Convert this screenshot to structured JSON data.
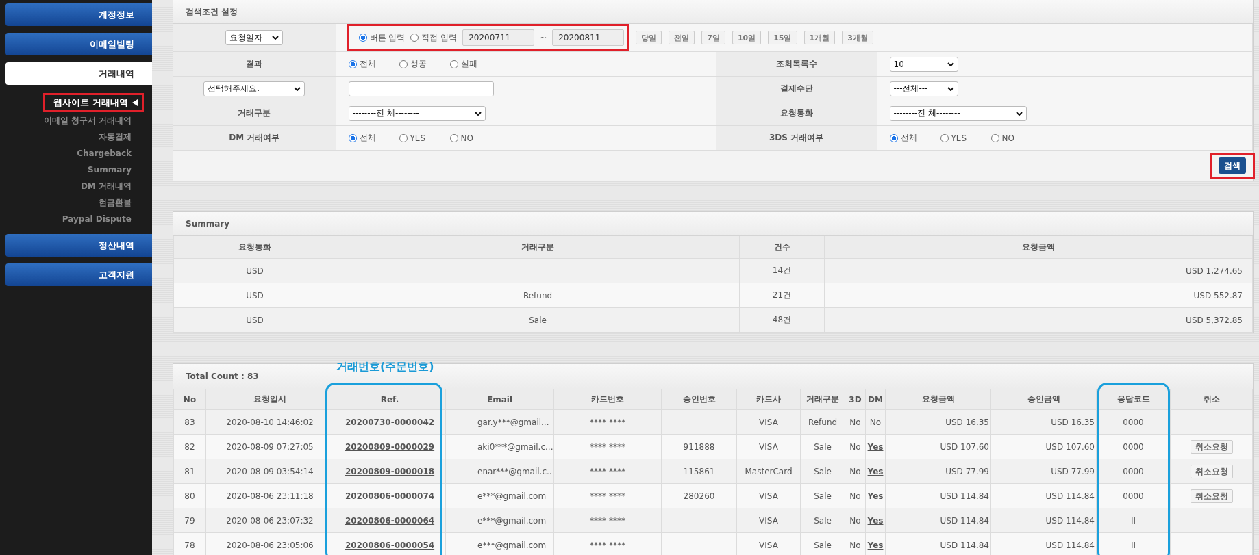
{
  "sidebar": {
    "menus": [
      {
        "label": "계정정보",
        "selected": false
      },
      {
        "label": "이메일빌링",
        "selected": false
      },
      {
        "label": "거래내역",
        "selected": true,
        "children": [
          {
            "label": "웹사이트 거래내역",
            "selected": true
          },
          {
            "label": "이메일 청구서 거래내역",
            "selected": false
          },
          {
            "label": "자동결제",
            "selected": false
          },
          {
            "label": "Chargeback",
            "selected": false
          },
          {
            "label": "Summary",
            "selected": false
          },
          {
            "label": "DM 거래내역",
            "selected": false
          },
          {
            "label": "현금환불",
            "selected": false
          },
          {
            "label": "Paypal Dispute",
            "selected": false
          }
        ]
      },
      {
        "label": "정산내역",
        "selected": false
      },
      {
        "label": "고객지원",
        "selected": false
      }
    ]
  },
  "search_panel": {
    "title": "검색조건 설정",
    "date_type": "요청일자",
    "date_modes": [
      {
        "label": "버튼 입력",
        "selected": true
      },
      {
        "label": "직접 입력",
        "selected": false
      }
    ],
    "date_from": "20200711",
    "date_separator": "~",
    "date_to": "20200811",
    "range_buttons": [
      "당일",
      "전일",
      "7일",
      "10일",
      "15일",
      "1개월",
      "3개월"
    ],
    "rows": [
      [
        {
          "label": "결과",
          "kind": "radio",
          "options": [
            {
              "label": "전체",
              "selected": true
            },
            {
              "label": "성공",
              "selected": false
            },
            {
              "label": "실패",
              "selected": false
            }
          ]
        },
        {
          "label": "조회목록수",
          "kind": "select",
          "value": "10"
        }
      ],
      [
        {
          "label_select": "선택해주세요.",
          "kind": "input"
        },
        {
          "label": "결제수단",
          "kind": "select",
          "value": "---전체---"
        }
      ],
      [
        {
          "label": "거래구분",
          "kind": "wide_select",
          "value": "--------전 체--------"
        },
        {
          "label": "요청통화",
          "kind": "wide_select",
          "value": "--------전 체--------"
        }
      ],
      [
        {
          "label": "DM 거래여부",
          "kind": "radio",
          "options": [
            {
              "label": "전체",
              "selected": true
            },
            {
              "label": "YES",
              "selected": false
            },
            {
              "label": "NO",
              "selected": false
            }
          ]
        },
        {
          "label": "3DS 거래여부",
          "kind": "radio",
          "options": [
            {
              "label": "전체",
              "selected": true
            },
            {
              "label": "YES",
              "selected": false
            },
            {
              "label": "NO",
              "selected": false
            }
          ]
        }
      ]
    ],
    "search_button": "검색"
  },
  "summary": {
    "title": "Summary",
    "columns": [
      "요청통화",
      "거래구분",
      "건수",
      "요청금액"
    ],
    "rows": [
      {
        "currency": "USD",
        "count": "14건",
        "amount": "USD 1,274.65"
      },
      {
        "currency": "USD",
        "type": "Refund",
        "count": "21건",
        "amount": "USD 552.87"
      },
      {
        "currency": "USD",
        "type": "Sale",
        "count": "48건",
        "amount": "USD 5,372.85"
      }
    ]
  },
  "transactions": {
    "total_count": "Total Count : 83",
    "annotation": "거래번호(주문번호)",
    "columns": [
      "No",
      "요청일시",
      "Ref.",
      "Email",
      "카드번호",
      "승인번호",
      "카드사",
      "거래구분",
      "3D",
      "DM",
      "요청금액",
      "승인금액",
      "응답코드",
      "취소"
    ],
    "rows": [
      {
        "no": "83",
        "date": "2020-08-10 14:46:02",
        "ref": "20200730-0000042",
        "email": "gar.y***@gmail...",
        "card": "**** ****",
        "card_company": "VISA",
        "type": "Refund",
        "three_d": "No",
        "dm": "No",
        "dm_linked": false,
        "request_amount": "USD 16.35",
        "approved_amount": "USD 16.35",
        "response_code": "0000"
      },
      {
        "no": "82",
        "date": "2020-08-09 07:27:05",
        "ref": "20200809-0000029",
        "email": "aki0***@gmail.c...",
        "card": "**** ****",
        "approval": "911888",
        "card_company": "VISA",
        "type": "Sale",
        "three_d": "No",
        "dm": "Yes",
        "dm_linked": true,
        "request_amount": "USD 107.60",
        "approved_amount": "USD 107.60",
        "response_code": "0000",
        "cancel": "취소요청"
      },
      {
        "no": "81",
        "date": "2020-08-09 03:54:14",
        "ref": "20200809-0000018",
        "email": "enar***@gmail.c...",
        "card": "**** ****",
        "approval": "115861",
        "card_company": "MasterCard",
        "type": "Sale",
        "three_d": "No",
        "dm": "Yes",
        "dm_linked": true,
        "request_amount": "USD 77.99",
        "approved_amount": "USD 77.99",
        "response_code": "0000",
        "cancel": "취소요청"
      },
      {
        "no": "80",
        "date": "2020-08-06 23:11:18",
        "ref": "20200806-0000074",
        "email": "e***@gmail.com",
        "card": "**** ****",
        "approval": "280260",
        "card_company": "VISA",
        "type": "Sale",
        "three_d": "No",
        "dm": "Yes",
        "dm_linked": true,
        "request_amount": "USD 114.84",
        "approved_amount": "USD 114.84",
        "response_code": "0000",
        "cancel": "취소요청"
      },
      {
        "no": "79",
        "date": "2020-08-06 23:07:32",
        "ref": "20200806-0000064",
        "email": "e***@gmail.com",
        "card": "**** ****",
        "card_company": "VISA",
        "type": "Sale",
        "three_d": "No",
        "dm": "Yes",
        "dm_linked": true,
        "request_amount": "USD 114.84",
        "approved_amount": "USD 114.84",
        "response_code": "II"
      },
      {
        "no": "78",
        "date": "2020-08-06 23:05:06",
        "ref": "20200806-0000054",
        "email": "e***@gmail.com",
        "card": "**** ****",
        "card_company": "VISA",
        "type": "Sale",
        "three_d": "No",
        "dm": "Yes",
        "dm_linked": true,
        "request_amount": "USD 114.84",
        "approved_amount": "USD 114.84",
        "response_code": "II"
      }
    ]
  }
}
